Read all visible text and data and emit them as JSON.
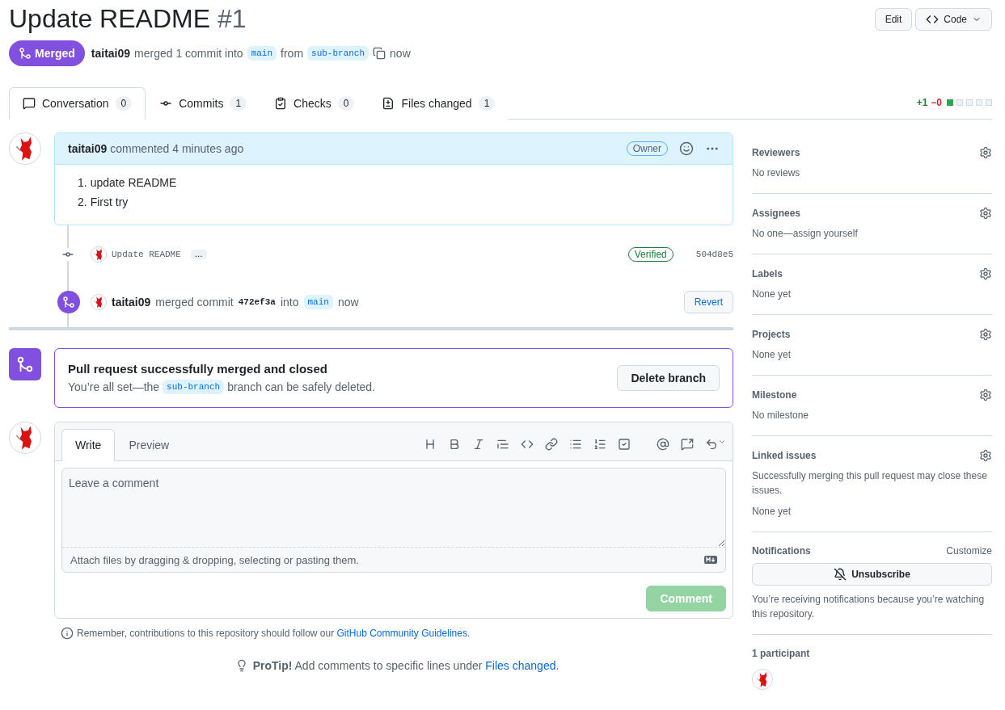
{
  "header": {
    "title": "Update README",
    "number": "#1",
    "buttons": [
      {
        "label": "Edit",
        "kind": "plain"
      },
      {
        "label": "Code",
        "kind": "code"
      }
    ],
    "status": "Merged",
    "author": "taitai09",
    "summary": "merged 1 commit into",
    "base_branch": "main",
    "from_word": "from",
    "head_branch": "sub-branch",
    "time": "now"
  },
  "tabs": [
    {
      "label": "Conversation",
      "count": "0",
      "kind": "conversation",
      "selected": true
    },
    {
      "label": "Commits",
      "count": "1",
      "kind": "commits",
      "selected": false
    },
    {
      "label": "Checks",
      "count": "0",
      "kind": "checks",
      "selected": false
    },
    {
      "label": "Files changed",
      "count": "1",
      "kind": "files",
      "selected": false
    }
  ],
  "diffstat": {
    "added": "+1",
    "removed": "−0",
    "blocks": [
      {
        "kind": "added"
      },
      {
        "kind": "neutral"
      },
      {
        "kind": "neutral"
      },
      {
        "kind": "neutral"
      },
      {
        "kind": "neutral"
      }
    ]
  },
  "comment": {
    "author": "taitai09",
    "action": "commented 4 minutes ago",
    "role": "Owner",
    "items": [
      {
        "marker": "1.",
        "text": "update README"
      },
      {
        "marker": "2.",
        "text": "First try"
      }
    ]
  },
  "commit": {
    "message": "Update README",
    "more": "…",
    "verified": "Verified",
    "sha": "504d8e5"
  },
  "merge_event": {
    "author": "taitai09",
    "action": "merged commit",
    "sha": "472ef3a",
    "into": "into",
    "branch": "main",
    "time": "now",
    "button": "Revert"
  },
  "merge_box": {
    "title": "Pull request successfully merged and closed",
    "text_before": "You’re all set—the",
    "branch": "sub-branch",
    "text_after": "branch can be safely deleted.",
    "button": "Delete branch"
  },
  "composer": {
    "tabs": [
      {
        "label": "Write",
        "selected": true
      },
      {
        "label": "Preview",
        "selected": false
      }
    ],
    "placeholder": "Leave a comment",
    "attach": "Attach files by dragging & dropping, selecting or pasting them.",
    "submit": {
      "label": "Comment",
      "disabled": true
    }
  },
  "notice": {
    "text": "Remember, contributions to this repository should follow our",
    "link": "GitHub Community Guidelines",
    "end": "."
  },
  "protip": {
    "text": "**ProTip!** Add comments to specific lines under",
    "link": "Files changed",
    "end": "."
  },
  "sidebar": {
    "sections": [
      {
        "title": "Reviewers",
        "value": "No reviews"
      },
      {
        "title": "Assignees",
        "value": "No one—assign yourself"
      },
      {
        "title": "Labels",
        "value": "None yet"
      },
      {
        "title": "Projects",
        "value": "None yet"
      },
      {
        "title": "Milestone",
        "value": "No milestone"
      },
      {
        "title": "Linked issues",
        "description": "Successfully merging this pull request may close these issues.",
        "value": "None yet"
      }
    ],
    "notifications": {
      "title": "Notifications",
      "action": "Customize",
      "button": "Unsubscribe",
      "note": "You’re receiving notifications because you’re watching this repository."
    },
    "participants": {
      "title": "1 participant"
    }
  }
}
